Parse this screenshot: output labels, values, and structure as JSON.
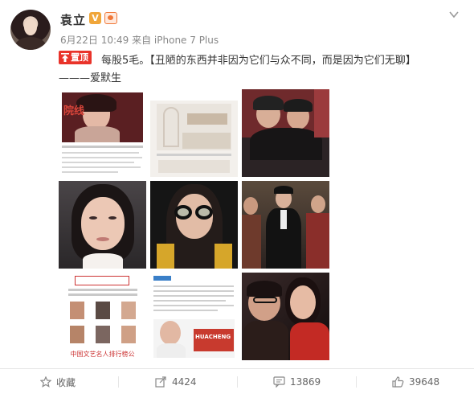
{
  "post": {
    "author": "袁立",
    "meta": "6月22日 10:49 来自 iPhone 7 Plus",
    "pinned_label": "置顶",
    "text_line1": "每股5毛。【丑陋的东西并非因为它们与众不同，而是因为它们无聊】",
    "text_line2": "———爱默生"
  },
  "photos": {
    "p1_caption": "院线",
    "p7_caption": "中国文艺名人排行榜公",
    "p8_caption": "HUACHENG"
  },
  "actions": {
    "favorite": "收藏",
    "repost_count": "4424",
    "comment_count": "13869",
    "like_count": "39648"
  },
  "colors": {
    "pinned_red": "#e9332a",
    "verified_orange": "#f0a63a",
    "meta_gray": "#888888"
  },
  "icons": [
    "avatar",
    "verified-v-icon",
    "level-badge-icon",
    "chevron-down-icon",
    "pin-arrow-icon",
    "star-icon",
    "repost-icon",
    "comment-icon",
    "thumbs-up-icon"
  ]
}
